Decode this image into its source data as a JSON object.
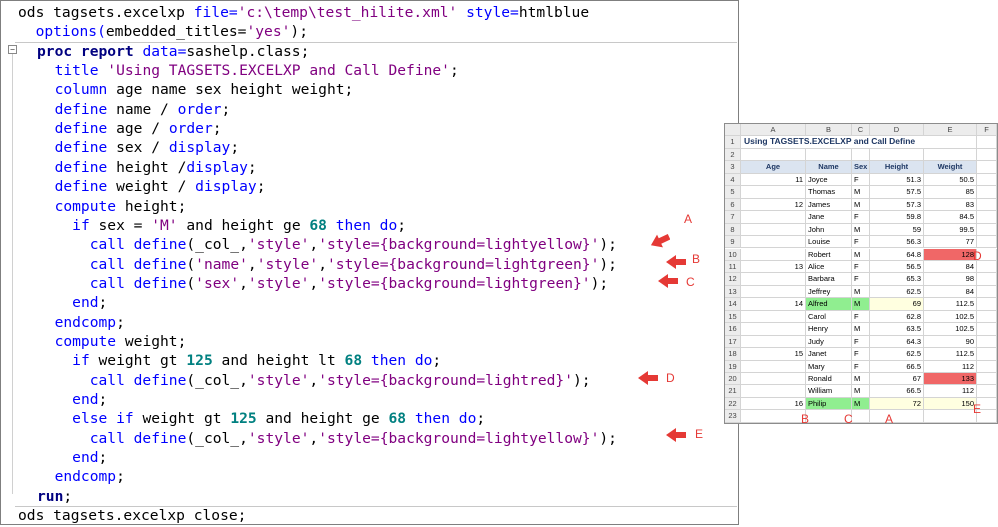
{
  "editor": {
    "lines": [
      [
        [
          "",
          "ods tagsets.excelxp "
        ],
        [
          "kw",
          "file="
        ],
        [
          "st",
          "'c:\\temp\\test_hilite.xml'"
        ],
        [
          "kw",
          " style="
        ],
        [
          "",
          "htmlblue"
        ]
      ],
      [
        [
          "",
          "  "
        ],
        [
          "kw",
          "options("
        ],
        [
          "",
          "embedded_titles="
        ],
        [
          "st",
          "'yes'"
        ],
        [
          "",
          ");"
        ]
      ],
      [
        [
          "pr",
          "proc report"
        ],
        [
          "kw",
          " data="
        ],
        [
          "",
          "sashelp.class;"
        ]
      ],
      [
        [
          "",
          "  "
        ],
        [
          "kw",
          "title "
        ],
        [
          "st",
          "'Using TAGSETS.EXCELXP and Call Define'"
        ],
        [
          "",
          ";"
        ]
      ],
      [
        [
          "",
          "  "
        ],
        [
          "kw",
          "column "
        ],
        [
          "",
          "age name sex height weight;"
        ]
      ],
      [
        [
          "",
          "  "
        ],
        [
          "kw",
          "define "
        ],
        [
          "",
          "name / "
        ],
        [
          "kw",
          "order"
        ],
        [
          "",
          ";"
        ]
      ],
      [
        [
          "",
          "  "
        ],
        [
          "kw",
          "define "
        ],
        [
          "",
          "age / "
        ],
        [
          "kw",
          "order"
        ],
        [
          "",
          ";"
        ]
      ],
      [
        [
          "",
          "  "
        ],
        [
          "kw",
          "define "
        ],
        [
          "",
          "sex / "
        ],
        [
          "kw",
          "display"
        ],
        [
          "",
          ";"
        ]
      ],
      [
        [
          "",
          "  "
        ],
        [
          "kw",
          "define "
        ],
        [
          "",
          "height /"
        ],
        [
          "kw",
          "display"
        ],
        [
          "",
          ";"
        ]
      ],
      [
        [
          "",
          "  "
        ],
        [
          "kw",
          "define "
        ],
        [
          "",
          "weight / "
        ],
        [
          "kw",
          "display"
        ],
        [
          "",
          ";"
        ]
      ],
      [
        [
          "",
          "  "
        ],
        [
          "kw",
          "compute "
        ],
        [
          "",
          "height;"
        ]
      ],
      [
        [
          "",
          "    "
        ],
        [
          "kw",
          "if "
        ],
        [
          "",
          "sex = "
        ],
        [
          "st",
          "'M'"
        ],
        [
          "",
          " and height ge "
        ],
        [
          "nu",
          "68"
        ],
        [
          "kw",
          " then do"
        ],
        [
          "",
          ";"
        ]
      ],
      [
        [
          "",
          "      "
        ],
        [
          "kw",
          "call define"
        ],
        [
          "",
          "(_col_,"
        ],
        [
          "st",
          "'style'"
        ],
        [
          "",
          ","
        ],
        [
          "st",
          "'style={background=lightyellow}'"
        ],
        [
          "",
          ");"
        ]
      ],
      [
        [
          "",
          "      "
        ],
        [
          "kw",
          "call define"
        ],
        [
          "",
          "("
        ],
        [
          "st",
          "'name'"
        ],
        [
          "",
          ","
        ],
        [
          "st",
          "'style'"
        ],
        [
          "",
          ","
        ],
        [
          "st",
          "'style={background=lightgreen}'"
        ],
        [
          "",
          ");"
        ]
      ],
      [
        [
          "",
          "      "
        ],
        [
          "kw",
          "call define"
        ],
        [
          "",
          "("
        ],
        [
          "st",
          "'sex'"
        ],
        [
          "",
          ","
        ],
        [
          "st",
          "'style'"
        ],
        [
          "",
          ","
        ],
        [
          "st",
          "'style={background=lightgreen}'"
        ],
        [
          "",
          ");"
        ]
      ],
      [
        [
          "",
          "    "
        ],
        [
          "kw",
          "end"
        ],
        [
          "",
          ";"
        ]
      ],
      [
        [
          "",
          "  "
        ],
        [
          "kw",
          "endcomp"
        ],
        [
          "",
          ";"
        ]
      ],
      [
        [
          "",
          "  "
        ],
        [
          "kw",
          "compute "
        ],
        [
          "",
          "weight;"
        ]
      ],
      [
        [
          "",
          "    "
        ],
        [
          "kw",
          "if "
        ],
        [
          "",
          "weight gt "
        ],
        [
          "nu",
          "125"
        ],
        [
          "",
          " and height lt "
        ],
        [
          "nu",
          "68"
        ],
        [
          "kw",
          " then do"
        ],
        [
          "",
          ";"
        ]
      ],
      [
        [
          "",
          "      "
        ],
        [
          "kw",
          "call define"
        ],
        [
          "",
          "(_col_,"
        ],
        [
          "st",
          "'style'"
        ],
        [
          "",
          ","
        ],
        [
          "st",
          "'style={background=lightred}'"
        ],
        [
          "",
          ");"
        ]
      ],
      [
        [
          "",
          "    "
        ],
        [
          "kw",
          "end"
        ],
        [
          "",
          ";"
        ]
      ],
      [
        [
          "",
          "    "
        ],
        [
          "kw",
          "else if "
        ],
        [
          "",
          "weight gt "
        ],
        [
          "nu",
          "125"
        ],
        [
          "",
          " and height ge "
        ],
        [
          "nu",
          "68"
        ],
        [
          "kw",
          " then do"
        ],
        [
          "",
          ";"
        ]
      ],
      [
        [
          "",
          "      "
        ],
        [
          "kw",
          "call define"
        ],
        [
          "",
          "(_col_,"
        ],
        [
          "st",
          "'style'"
        ],
        [
          "",
          ","
        ],
        [
          "st",
          "'style={background=lightyellow}'"
        ],
        [
          "",
          ");"
        ]
      ],
      [
        [
          "",
          "    "
        ],
        [
          "kw",
          "end"
        ],
        [
          "",
          ";"
        ]
      ],
      [
        [
          "",
          "  "
        ],
        [
          "kw",
          "endcomp"
        ],
        [
          "",
          ";"
        ]
      ],
      [
        [
          "pr",
          "run"
        ],
        [
          "",
          ";"
        ]
      ],
      [
        [
          "",
          "ods tagsets.excelxp close;"
        ]
      ]
    ],
    "fold_symbol": "−"
  },
  "callouts": [
    "A",
    "B",
    "C",
    "D",
    "E"
  ],
  "sheet": {
    "col_headers": [
      "A",
      "B",
      "C",
      "D",
      "E",
      "F"
    ],
    "title": "Using TAGSETS.EXCELXP and Call Define",
    "headers": [
      "Age",
      "Name",
      "Sex",
      "Height",
      "Weight"
    ],
    "rows": [
      {
        "rn": "4",
        "age": "11",
        "name": "Joyce",
        "sex": "F",
        "height": "51.3",
        "weight": "50.5"
      },
      {
        "rn": "5",
        "age": "",
        "name": "Thomas",
        "sex": "M",
        "height": "57.5",
        "weight": "85"
      },
      {
        "rn": "6",
        "age": "12",
        "name": "James",
        "sex": "M",
        "height": "57.3",
        "weight": "83"
      },
      {
        "rn": "7",
        "age": "",
        "name": "Jane",
        "sex": "F",
        "height": "59.8",
        "weight": "84.5"
      },
      {
        "rn": "8",
        "age": "",
        "name": "John",
        "sex": "M",
        "height": "59",
        "weight": "99.5"
      },
      {
        "rn": "9",
        "age": "",
        "name": "Louise",
        "sex": "F",
        "height": "56.3",
        "weight": "77"
      },
      {
        "rn": "10",
        "age": "",
        "name": "Robert",
        "sex": "M",
        "height": "64.8",
        "weight": "128",
        "wbg": "#f06767"
      },
      {
        "rn": "11",
        "age": "13",
        "name": "Alice",
        "sex": "F",
        "height": "56.5",
        "weight": "84"
      },
      {
        "rn": "12",
        "age": "",
        "name": "Barbara",
        "sex": "F",
        "height": "65.3",
        "weight": "98"
      },
      {
        "rn": "13",
        "age": "",
        "name": "Jeffrey",
        "sex": "M",
        "height": "62.5",
        "weight": "84"
      },
      {
        "rn": "14",
        "age": "14",
        "name": "Alfred",
        "sex": "M",
        "height": "69",
        "weight": "112.5",
        "nbg": "#90ee90",
        "sbg": "#90ee90",
        "hbg": "#ffffe0"
      },
      {
        "rn": "15",
        "age": "",
        "name": "Carol",
        "sex": "F",
        "height": "62.8",
        "weight": "102.5"
      },
      {
        "rn": "16",
        "age": "",
        "name": "Henry",
        "sex": "M",
        "height": "63.5",
        "weight": "102.5"
      },
      {
        "rn": "17",
        "age": "",
        "name": "Judy",
        "sex": "F",
        "height": "64.3",
        "weight": "90"
      },
      {
        "rn": "18",
        "age": "15",
        "name": "Janet",
        "sex": "F",
        "height": "62.5",
        "weight": "112.5"
      },
      {
        "rn": "19",
        "age": "",
        "name": "Mary",
        "sex": "F",
        "height": "66.5",
        "weight": "112"
      },
      {
        "rn": "20",
        "age": "",
        "name": "Ronald",
        "sex": "M",
        "height": "67",
        "weight": "133",
        "wbg": "#f06767"
      },
      {
        "rn": "21",
        "age": "",
        "name": "William",
        "sex": "M",
        "height": "66.5",
        "weight": "112"
      },
      {
        "rn": "22",
        "age": "16",
        "name": "Philip",
        "sex": "M",
        "height": "72",
        "weight": "150",
        "nbg": "#90ee90",
        "sbg": "#90ee90",
        "hbg": "#ffffe0",
        "wbg": "#ffffe0"
      },
      {
        "rn": "23",
        "age": "",
        "name": "",
        "sex": "",
        "height": "",
        "weight": ""
      }
    ],
    "side_labels": {
      "row10": "D",
      "row22": "E"
    },
    "bottom_labels": [
      "B",
      "C",
      "A"
    ]
  },
  "colors": {
    "callout": "#e53935",
    "lightred": "#f06767",
    "lightgreen": "#90ee90",
    "lightyellow": "#ffffe0"
  }
}
